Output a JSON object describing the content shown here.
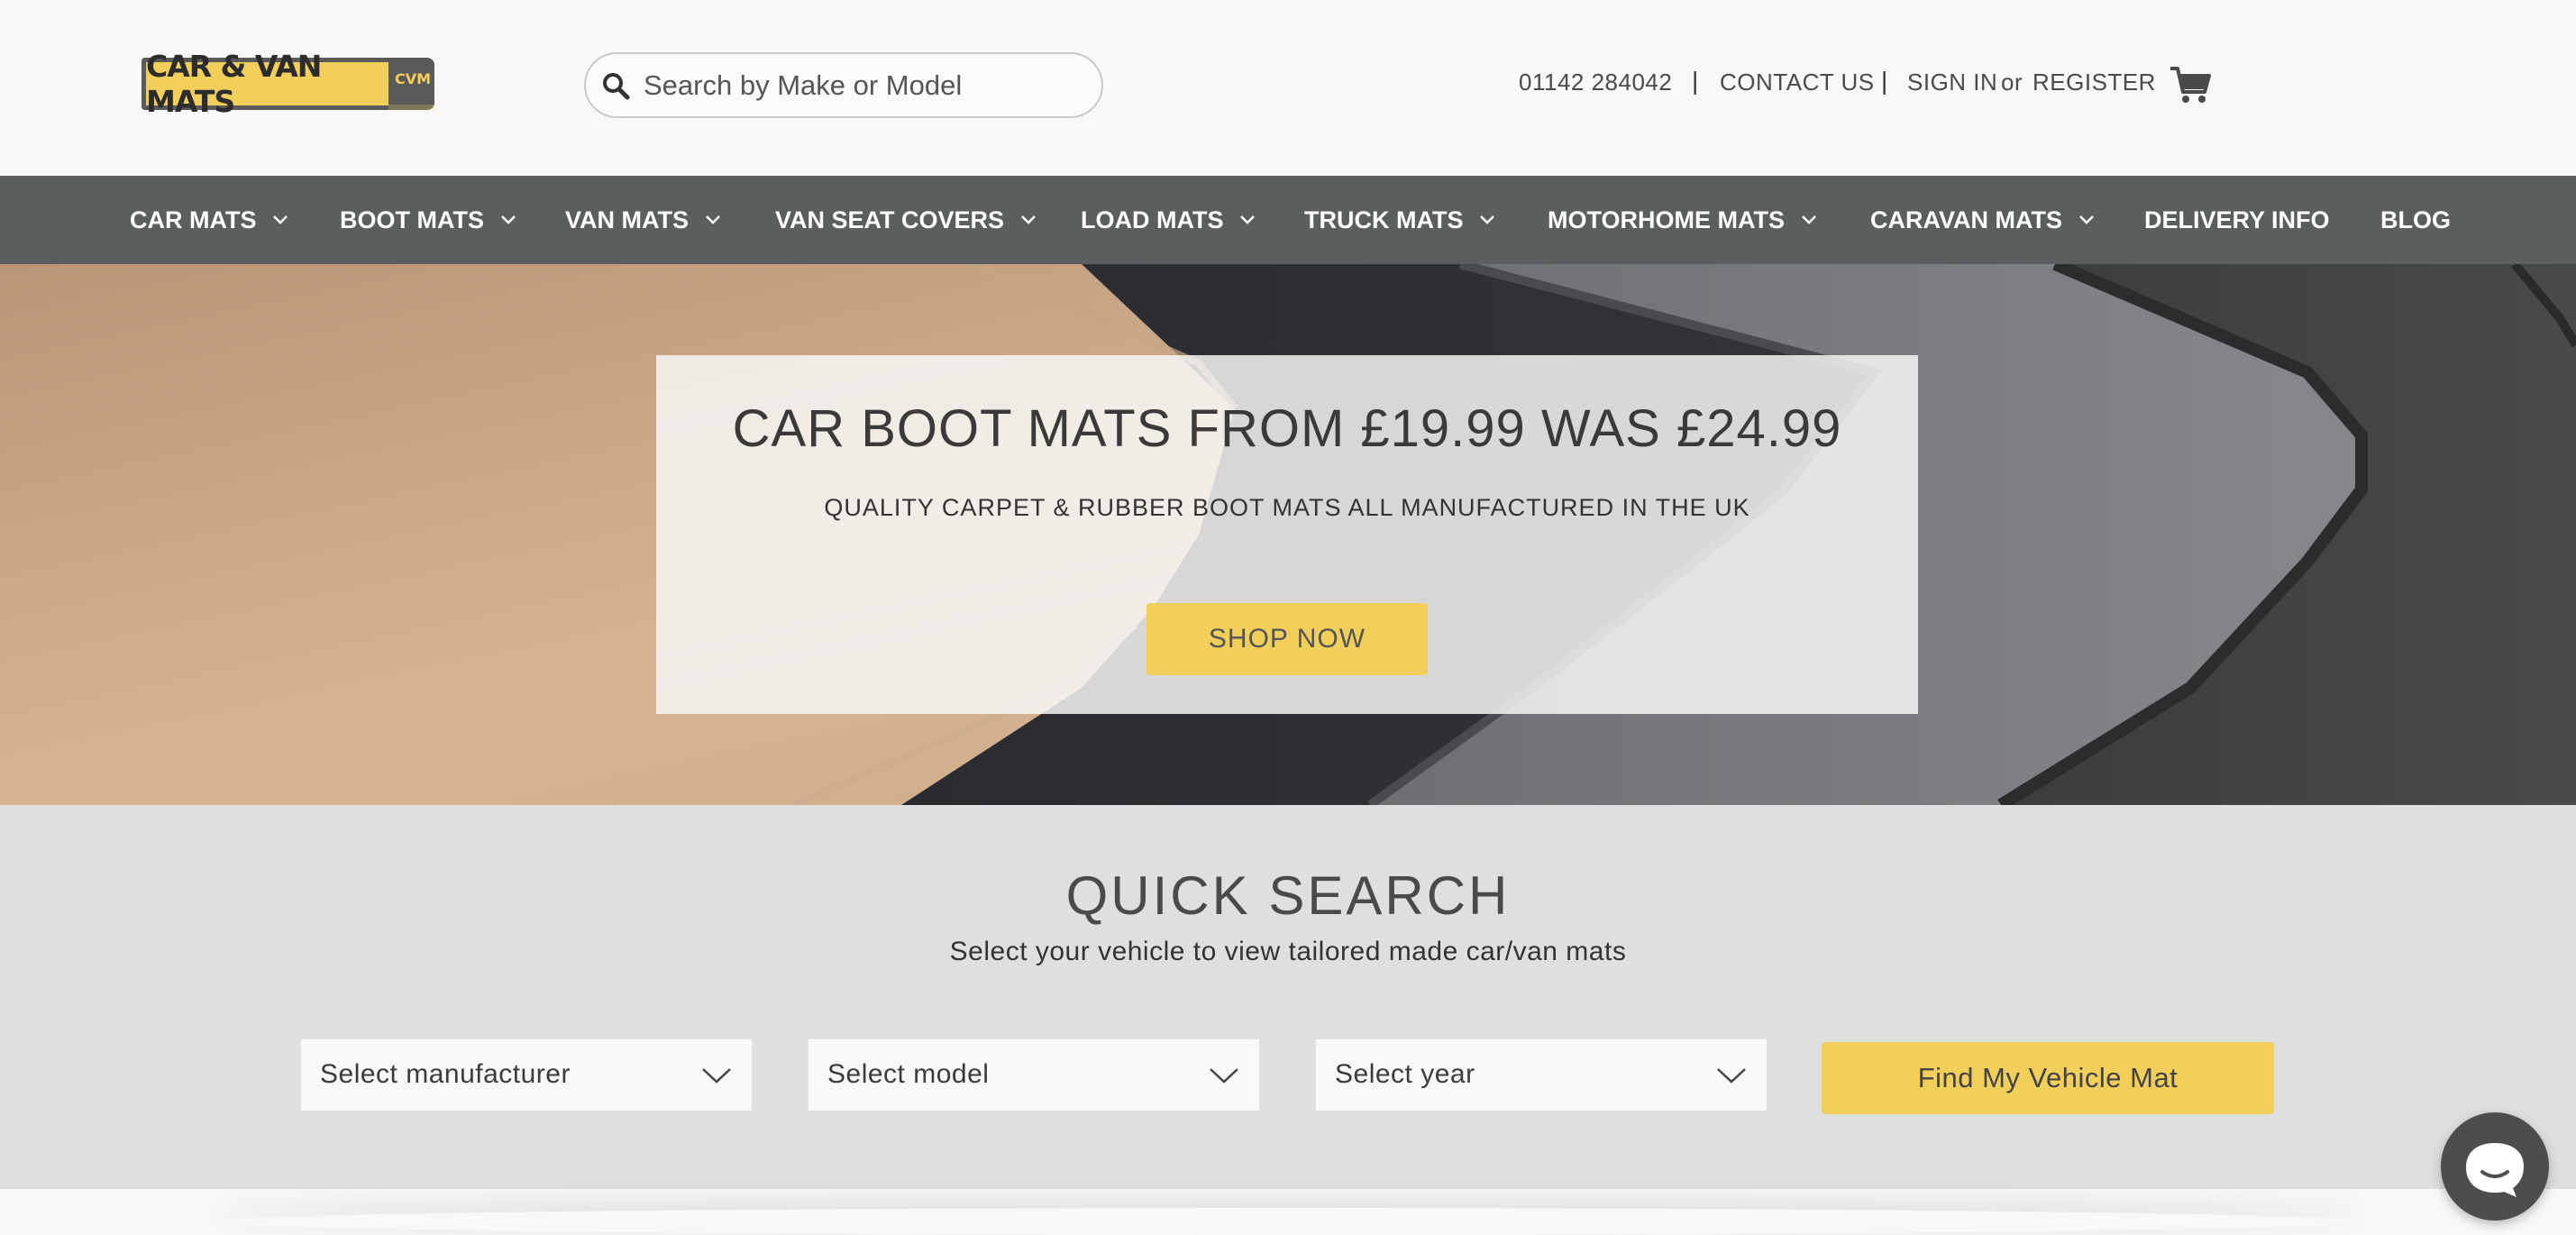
{
  "header": {
    "logo": {
      "text": "CAR & VAN MATS",
      "badge": "CVM"
    },
    "search": {
      "placeholder": "Search by Make or Model",
      "icon": "search-icon"
    },
    "phone": "01142 284042",
    "separator": "|",
    "contact": "CONTACT US",
    "sign_in": "SIGN IN",
    "or": "or",
    "register": "REGISTER",
    "cart_icon": "cart-icon"
  },
  "nav": {
    "items": [
      {
        "label": "CAR MATS",
        "has_dropdown": true
      },
      {
        "label": "BOOT MATS",
        "has_dropdown": true
      },
      {
        "label": "VAN MATS",
        "has_dropdown": true
      },
      {
        "label": "VAN SEAT COVERS",
        "has_dropdown": true
      },
      {
        "label": "LOAD MATS",
        "has_dropdown": true
      },
      {
        "label": "TRUCK MATS",
        "has_dropdown": true
      },
      {
        "label": "MOTORHOME MATS",
        "has_dropdown": true
      },
      {
        "label": "CARAVAN MATS",
        "has_dropdown": true
      },
      {
        "label": "DELIVERY INFO",
        "has_dropdown": false
      },
      {
        "label": "BLOG",
        "has_dropdown": false
      }
    ]
  },
  "hero": {
    "title": "CAR BOOT MATS FROM £19.99 WAS £24.99",
    "subtitle": "QUALITY CARPET & RUBBER BOOT MATS ALL MANUFACTURED IN THE UK",
    "button": "SHOP NOW"
  },
  "quick_search": {
    "title": "QUICK SEARCH",
    "subtitle": "Select your vehicle to view tailored made car/van mats",
    "manufacturer": "Select manufacturer",
    "model": "Select model",
    "year": "Select year",
    "button": "Find My Vehicle Mat"
  },
  "colors": {
    "accent": "#f2cf5b",
    "nav_bg": "#5b5e5e",
    "quick_search_bg": "#dfdfdf",
    "page_bg": "#f9f8f7"
  },
  "chat_icon": "chat-bubble-icon"
}
